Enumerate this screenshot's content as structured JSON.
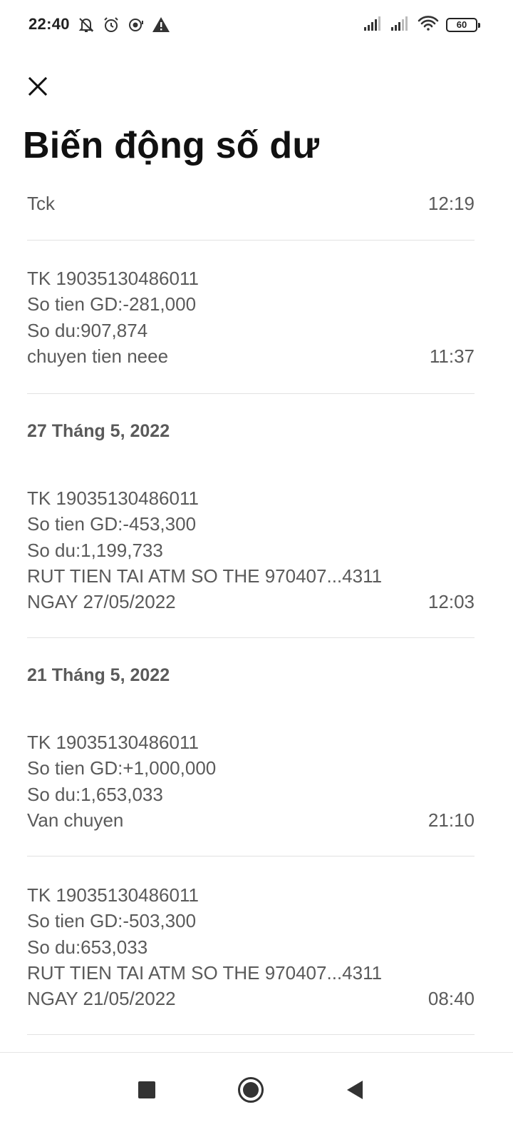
{
  "status_bar": {
    "time": "22:40",
    "battery": "60",
    "icons": [
      "bell-off-icon",
      "alarm-icon",
      "notification-icon",
      "warning-icon",
      "signal-icon",
      "signal-icon",
      "wifi-icon",
      "battery-icon"
    ]
  },
  "header": {
    "close_icon": "close-icon",
    "title": "Biến động số dư"
  },
  "messages": [
    {
      "lines": [
        "Tck"
      ],
      "time": "12:19"
    },
    {
      "lines": [
        "TK 19035130486011",
        "So tien GD:-281,000",
        "So du:907,874",
        "chuyen tien neee"
      ],
      "time": "11:37"
    },
    {
      "date": "27 Tháng 5, 2022"
    },
    {
      "lines": [
        "TK 19035130486011",
        "So tien GD:-453,300",
        "So du:1,199,733",
        "RUT TIEN TAI ATM SO THE 970407...4311",
        "NGAY 27/05/2022"
      ],
      "time": "12:03"
    },
    {
      "date": "21 Tháng 5, 2022"
    },
    {
      "lines": [
        "TK 19035130486011",
        "So tien GD:+1,000,000",
        "So du:1,653,033",
        "Van chuyen"
      ],
      "time": "21:10"
    },
    {
      "lines": [
        "TK 19035130486011",
        "So tien GD:-503,300",
        "So du:653,033",
        "RUT TIEN TAI ATM SO THE 970407...4311",
        "NGAY 21/05/2022"
      ],
      "time": "08:40"
    }
  ],
  "nav_bar": {
    "recents_icon": "square-icon",
    "home_icon": "circle-icon",
    "back_icon": "triangle-back-icon"
  }
}
